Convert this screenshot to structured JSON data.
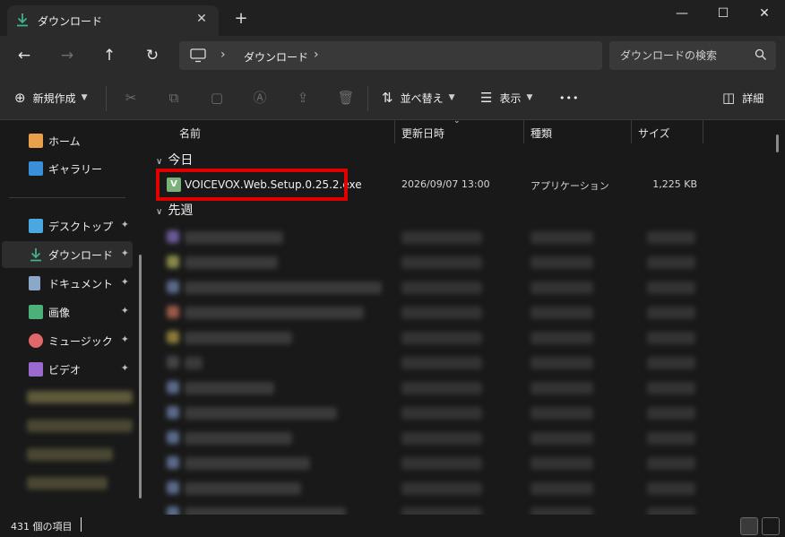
{
  "window": {
    "tab_title": "ダウンロード",
    "tab_close": "✕",
    "new_tab": "+",
    "minimize": "—",
    "maximize": "☐",
    "close": "✕"
  },
  "nav": {
    "back": "←",
    "forward": "→",
    "up": "↑",
    "refresh": "↻",
    "breadcrumb_sep": "›",
    "breadcrumb": "ダウンロード",
    "search_placeholder": "ダウンロードの検索"
  },
  "toolbar": {
    "new_label": "新規作成",
    "sort_label": "並べ替え",
    "view_label": "表示",
    "more": "•••",
    "details_label": "詳細"
  },
  "sidebar": {
    "home": "ホーム",
    "gallery": "ギャラリー",
    "desktop": "デスクトップ",
    "downloads": "ダウンロード",
    "documents": "ドキュメント",
    "pictures": "画像",
    "music": "ミュージック",
    "videos": "ビデオ",
    "pin": "📌"
  },
  "columns": {
    "name": "名前",
    "modified": "更新日時",
    "type": "種類",
    "size": "サイズ"
  },
  "groups": {
    "today": "今日",
    "last_week": "先週"
  },
  "files_today": [
    {
      "icon_letter": "V",
      "name": "VOICEVOX.Web.Setup.0.25.2.exe",
      "modified": "2026/09/07 13:00",
      "type": "アプリケーション",
      "size": "1,225 KB"
    }
  ],
  "status": {
    "item_count": "431 個の項目"
  },
  "colors": {
    "background": "#191919",
    "toolbar": "#2b2b2b",
    "highlight_border": "#e00000",
    "download_green": "#3fb28c"
  }
}
